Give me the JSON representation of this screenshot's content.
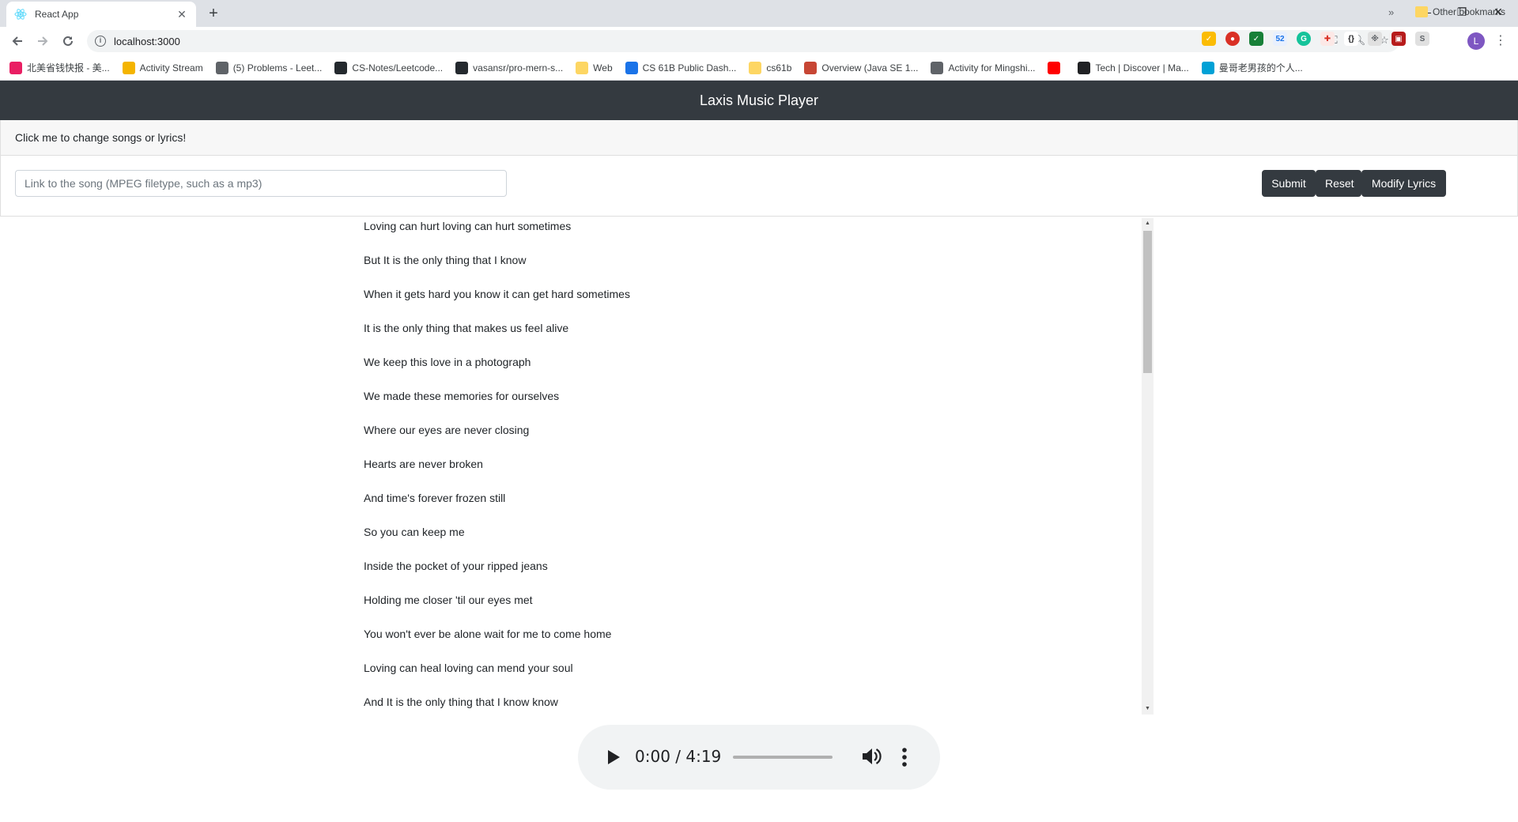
{
  "browser": {
    "tab_title": "React App",
    "url": "localhost:3000",
    "profile_initial": "L",
    "extension_badge": "52",
    "bookmarks": [
      {
        "label": "北美省钱快报 - 美...",
        "icon": "moon-icon",
        "color": "#e91e63"
      },
      {
        "label": "Activity Stream",
        "icon": "stream-icon",
        "color": "#f4b400"
      },
      {
        "label": "(5) Problems - Leet...",
        "icon": "globe-icon",
        "color": "#5f6368"
      },
      {
        "label": "CS-Notes/Leetcode...",
        "icon": "github-icon",
        "color": "#24292e"
      },
      {
        "label": "vasansr/pro-mern-s...",
        "icon": "github-icon",
        "color": "#24292e"
      },
      {
        "label": "Web",
        "icon": "folder-icon",
        "color": "#fdd663"
      },
      {
        "label": "CS 61B Public Dash...",
        "icon": "chart-icon",
        "color": "#1a73e8"
      },
      {
        "label": "cs61b",
        "icon": "folder-icon",
        "color": "#fdd663"
      },
      {
        "label": "Overview (Java SE 1...",
        "icon": "oracle-icon",
        "color": "#c74634"
      },
      {
        "label": "Activity for Mingshi...",
        "icon": "person-icon",
        "color": "#5f6368"
      },
      {
        "label": "",
        "icon": "youtube-icon",
        "color": "#ff0000"
      },
      {
        "label": "Tech | Discover | Ma...",
        "icon": "dev-icon",
        "color": "#202124"
      },
      {
        "label": "曼哥老男孩的个人...",
        "icon": "bilibili-icon",
        "color": "#00a1d6"
      }
    ],
    "more_bookmarks": "»",
    "other_bookmarks": "Other bookmarks"
  },
  "app": {
    "title": "Laxis Music Player",
    "toggle_text": "Click me to change songs or lyrics!",
    "input_placeholder": "Link to the song (MPEG filetype, such as a mp3)",
    "input_value": "",
    "buttons": {
      "submit": "Submit",
      "reset": "Reset",
      "modify": "Modify Lyrics"
    },
    "lyrics": [
      "Loving can hurt loving can hurt sometimes",
      "But It is the only thing that I know",
      "When it gets hard you know it can get hard sometimes",
      "It is the only thing that makes us feel alive",
      "We keep this love in a photograph",
      "We made these memories for ourselves",
      "Where our eyes are never closing",
      "Hearts are never broken",
      "And time's forever frozen still",
      "So you can keep me",
      "Inside the pocket of your ripped jeans",
      "Holding me closer 'til our eyes met",
      "You won't ever be alone wait for me to come home",
      "Loving can heal loving can mend your soul",
      "And It is the only thing that I know know"
    ],
    "player": {
      "time": "0:00 / 4:19",
      "progress": 0
    }
  },
  "colors": {
    "navbar": "#343a40",
    "button": "#343a40",
    "player_bg": "#f1f3f4"
  }
}
